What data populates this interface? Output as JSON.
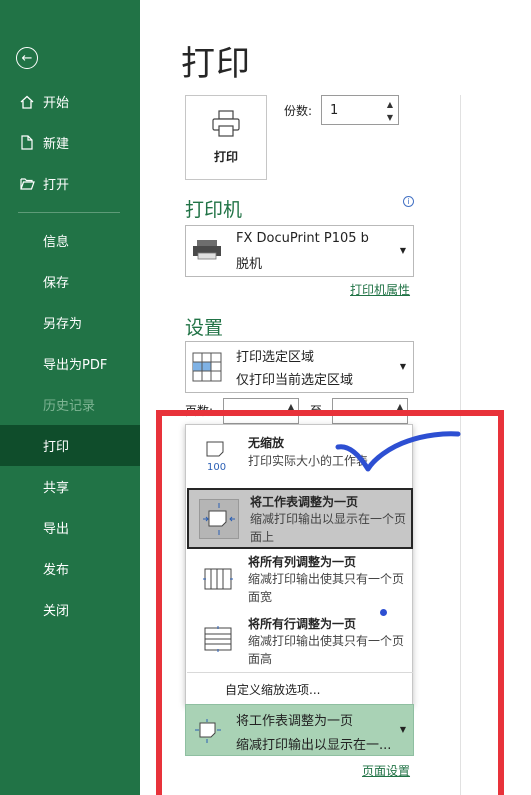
{
  "nav": {
    "back_icon": "back-arrow-icon",
    "items": [
      {
        "label": "开始",
        "icon": "home-icon"
      },
      {
        "label": "新建",
        "icon": "new-file-icon"
      },
      {
        "label": "打开",
        "icon": "open-folder-icon"
      },
      {
        "label": "信息"
      },
      {
        "label": "保存"
      },
      {
        "label": "另存为"
      },
      {
        "label": "导出为PDF"
      },
      {
        "label": "历史记录",
        "disabled": true
      },
      {
        "label": "打印",
        "active": true
      },
      {
        "label": "共享"
      },
      {
        "label": "导出"
      },
      {
        "label": "发布"
      },
      {
        "label": "关闭"
      }
    ]
  },
  "main": {
    "title": "打印",
    "print_button_label": "打印",
    "copies_label": "份数:",
    "copies_value": "1",
    "printer_heading": "打印机",
    "printer_name": "FX DocuPrint P105 b",
    "printer_status": "脱机",
    "printer_properties_link": "打印机属性",
    "settings_heading": "设置",
    "print_area_title": "打印选定区域",
    "print_area_desc": "仅打印当前选定区域",
    "pages_label": "页数:",
    "to_label": "至"
  },
  "scaling_menu": {
    "options": [
      {
        "title": "无缩放",
        "desc": "打印实际大小的工作表",
        "icon": "no-scaling-icon",
        "icon_text": "100"
      },
      {
        "title": "将工作表调整为一页",
        "desc": "缩减打印输出以显示在一个页面上",
        "icon": "fit-sheet-icon",
        "selected": true
      },
      {
        "title": "将所有列调整为一页",
        "desc": "缩减打印输出使其只有一个页面宽",
        "icon": "fit-columns-icon"
      },
      {
        "title": "将所有行调整为一页",
        "desc": "缩减打印输出使其只有一个页面高",
        "icon": "fit-rows-icon"
      }
    ],
    "custom_label": "自定义缩放选项..."
  },
  "scaling_dropdown": {
    "title": "将工作表调整为一页",
    "desc": "缩减打印输出以显示在一..."
  },
  "page_setup_link": "页面设置",
  "colors": {
    "sidebar": "#217346",
    "sidebar_active": "#0f4d2b",
    "accent": "#217346",
    "annotation_red": "#e8323a",
    "annotation_blue": "#2d4fd2"
  }
}
